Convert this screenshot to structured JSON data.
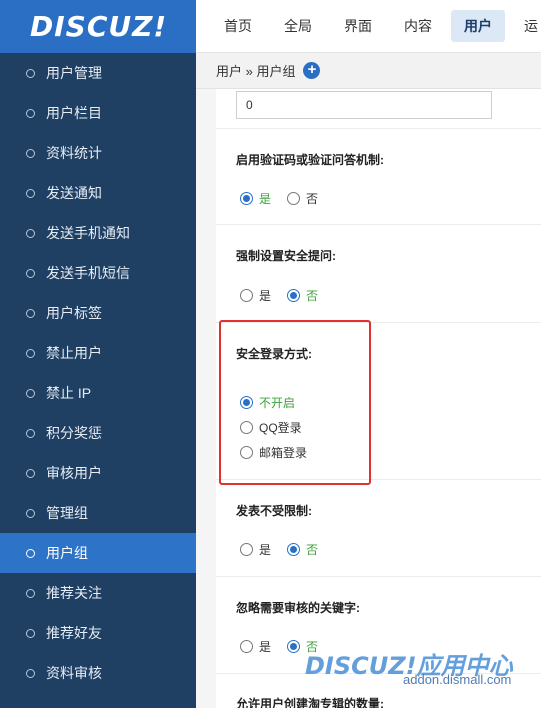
{
  "app": {
    "logo": "DISCUZ!"
  },
  "sidebar": {
    "items": [
      {
        "label": "用户管理"
      },
      {
        "label": "用户栏目"
      },
      {
        "label": "资料统计"
      },
      {
        "label": "发送通知"
      },
      {
        "label": "发送手机通知"
      },
      {
        "label": "发送手机短信"
      },
      {
        "label": "用户标签"
      },
      {
        "label": "禁止用户"
      },
      {
        "label": "禁止 IP"
      },
      {
        "label": "积分奖惩"
      },
      {
        "label": "审核用户"
      },
      {
        "label": "管理组"
      },
      {
        "label": "用户组"
      },
      {
        "label": "推荐关注"
      },
      {
        "label": "推荐好友"
      },
      {
        "label": "资料审核"
      }
    ],
    "active_index": 12
  },
  "topnav": {
    "tabs": [
      "首页",
      "全局",
      "界面",
      "内容",
      "用户",
      "运"
    ],
    "active": "用户"
  },
  "breadcrumb": {
    "text": "用户 » 用户组"
  },
  "form": {
    "number_value": "0",
    "captcha": {
      "label": "启用验证码或验证问答机制:",
      "yes": "是",
      "no": "否",
      "selected": "yes"
    },
    "security_question": {
      "label": "强制设置安全提问:",
      "yes": "是",
      "no": "否",
      "selected": "no"
    },
    "secure_login": {
      "label": "安全登录方式:",
      "options": [
        "不开启",
        "QQ登录",
        "邮箱登录"
      ],
      "selected": 0
    },
    "post_unlimited": {
      "label": "发表不受限制:",
      "yes": "是",
      "no": "否",
      "selected": "no"
    },
    "ignore_keywords": {
      "label": "忽略需要审核的关键字:",
      "yes": "是",
      "no": "否",
      "selected": "no"
    },
    "album_limit": {
      "label": "允许用户创建淘专辑的数量:"
    }
  },
  "watermark": {
    "brand": "DISCUZ!应用中心",
    "site": "addon.dismall.com"
  },
  "colors": {
    "sidebar_bg": "#1f3f63",
    "accent": "#2b6fc4",
    "highlight": "#e03030",
    "selected_text": "#3ca23c"
  }
}
